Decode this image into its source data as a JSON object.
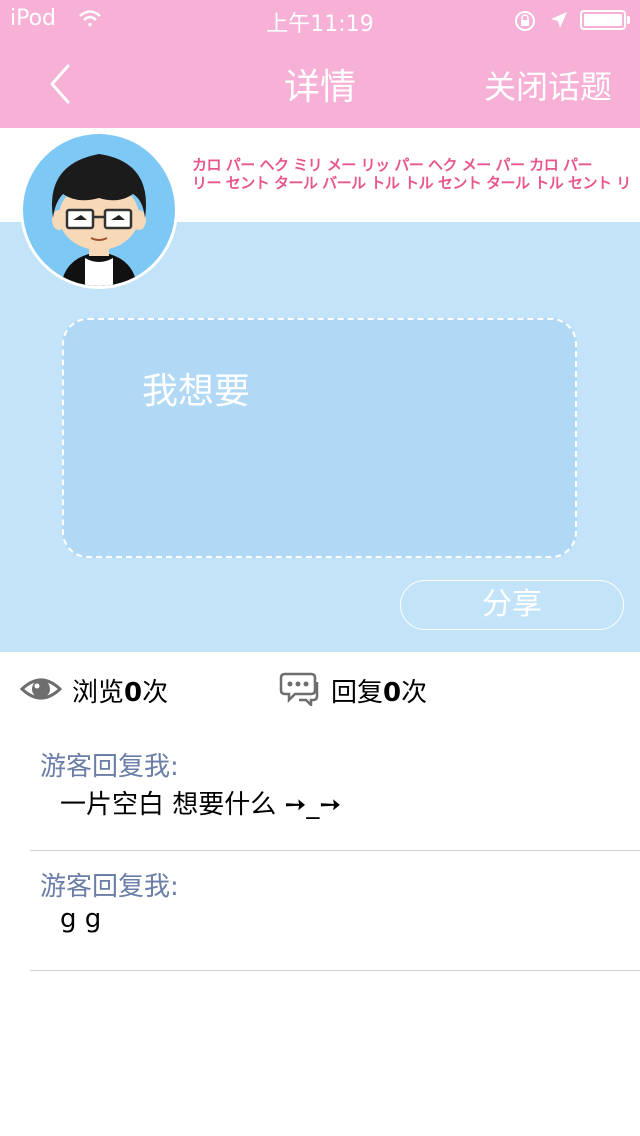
{
  "status_bar": {
    "carrier": "iPod",
    "time": "上午11:19",
    "icons": [
      "wifi-icon",
      "rotation-lock-icon",
      "location-arrow-icon",
      "battery-icon"
    ]
  },
  "nav": {
    "back_icon": "chevron-left-icon",
    "title": "详情",
    "close_label": "关闭话题"
  },
  "marquee": {
    "line1": "カロ パー ヘク ミリ メー リッ パー ヘク メー パー カロ パー",
    "line2": "リー セント タール バール トル トル セント タール トル セント リー セント"
  },
  "post": {
    "content": "我想要",
    "share_label": "分享"
  },
  "stats": {
    "views_prefix": "浏览",
    "views_count": "0",
    "views_suffix": "次",
    "replies_prefix": "回复",
    "replies_count": "0",
    "replies_suffix": "次"
  },
  "replies": [
    {
      "author": "游客回复我:",
      "text": "一片空白  想要什么  ➙_➙"
    },
    {
      "author": "游客回复我:",
      "text": "g g"
    }
  ],
  "colors": {
    "header_pink": "#f7b1d6",
    "content_blue": "#c3e3f9",
    "marquee_text": "#e8568e",
    "reply_author": "#6b7ea8"
  }
}
